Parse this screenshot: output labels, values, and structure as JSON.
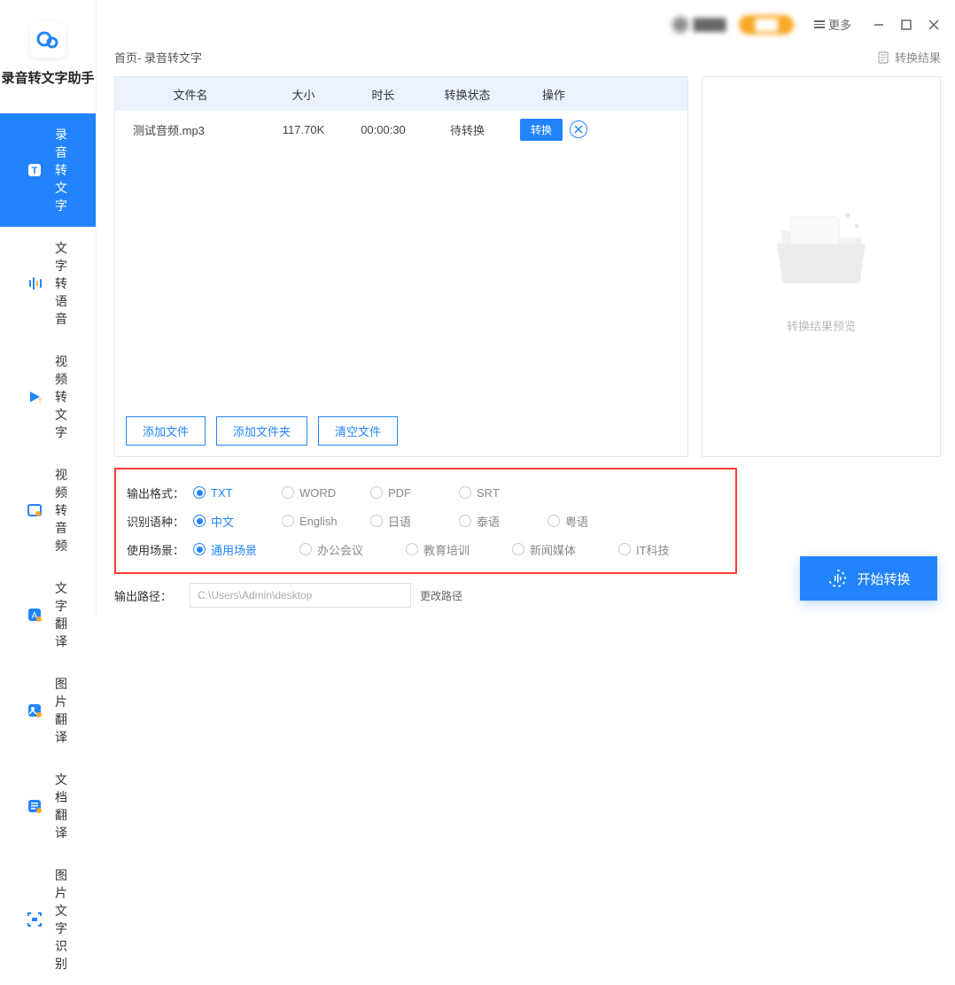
{
  "app": {
    "title": "录音转文字助手"
  },
  "titlebar": {
    "more": "更多"
  },
  "sidebar": {
    "items": [
      {
        "label": "录音转文字",
        "active": true
      },
      {
        "label": "文字转语音"
      },
      {
        "label": "视频转文字"
      },
      {
        "label": "视频转音频"
      },
      {
        "label": "文字翻译"
      },
      {
        "label": "图片翻译"
      },
      {
        "label": "文档翻译"
      },
      {
        "label": "图片文字识别"
      }
    ]
  },
  "breadcrumb": {
    "text": "首页- 录音转文字",
    "result": "转换结果"
  },
  "table": {
    "headers": {
      "name": "文件名",
      "size": "大小",
      "duration": "时长",
      "status": "转换状态",
      "op": "操作"
    },
    "rows": [
      {
        "name": "测试音频.mp3",
        "size": "117.70K",
        "duration": "00:00:30",
        "status": "待转换",
        "convert": "转换"
      }
    ]
  },
  "fileButtons": {
    "add": "添加文件",
    "addFolder": "添加文件夹",
    "clear": "清空文件"
  },
  "preview": {
    "label": "转换结果预览"
  },
  "settings": {
    "format": {
      "label": "输出格式：",
      "options": [
        "TXT",
        "WORD",
        "PDF",
        "SRT"
      ],
      "selected": 0
    },
    "language": {
      "label": "识别语种：",
      "options": [
        "中文",
        "English",
        "日语",
        "泰语",
        "粤语"
      ],
      "selected": 0
    },
    "scene": {
      "label": "使用场景：",
      "options": [
        "通用场景",
        "办公会议",
        "教育培训",
        "新闻媒体",
        "IT科技"
      ],
      "selected": 0
    }
  },
  "output": {
    "label": "输出路径：",
    "path": "C:\\Users\\Admin\\desktop",
    "change": "更改路径"
  },
  "start": {
    "label": "开始转换"
  }
}
